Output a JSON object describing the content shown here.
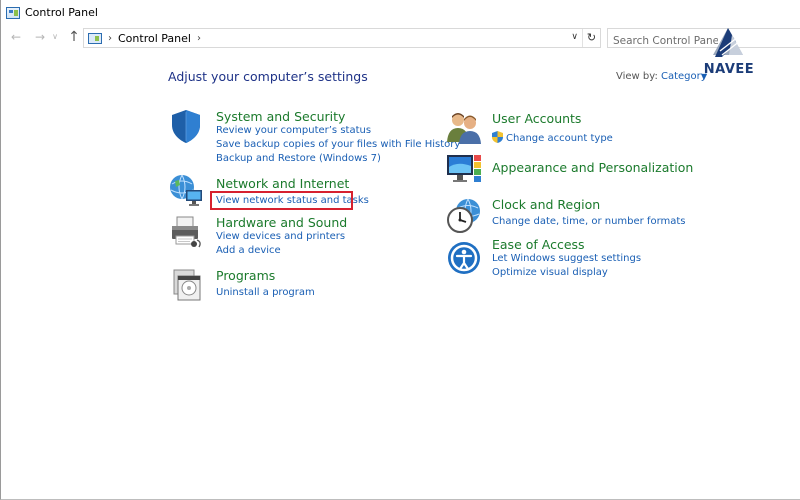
{
  "window": {
    "title": "Control Panel"
  },
  "address_bar": {
    "path": "Control Panel",
    "separator": "›"
  },
  "search": {
    "placeholder": "Search Control Panel"
  },
  "logo": {
    "text": "NAVEE"
  },
  "main": {
    "heading": "Adjust your computer’s settings",
    "view_by_label": "View by:",
    "view_by_value": "Category"
  },
  "categories_left": [
    {
      "title": "System and Security",
      "icon": "shield-icon",
      "links": [
        "Review your computer’s status",
        "Save backup copies of your files with File History",
        "Backup and Restore (Windows 7)"
      ]
    },
    {
      "title": "Network and Internet",
      "icon": "network-globe-icon",
      "links": [
        "View network status and tasks"
      ]
    },
    {
      "title": "Hardware and Sound",
      "icon": "printer-icon",
      "links": [
        "View devices and printers",
        "Add a device"
      ]
    },
    {
      "title": "Programs",
      "icon": "programs-icon",
      "links": [
        "Uninstall a program"
      ]
    }
  ],
  "categories_right": [
    {
      "title": "User Accounts",
      "icon": "users-icon",
      "links": [
        "Change account type"
      ]
    },
    {
      "title": "Appearance and Personalization",
      "icon": "monitor-palette-icon",
      "links": []
    },
    {
      "title": "Clock and Region",
      "icon": "clock-globe-icon",
      "links": [
        "Change date, time, or number formats"
      ]
    },
    {
      "title": "Ease of Access",
      "icon": "ease-of-access-icon",
      "links": [
        "Let Windows suggest settings",
        "Optimize visual display"
      ]
    }
  ],
  "highlight": {
    "color": "#d6212f",
    "target": "View network status and tasks"
  },
  "colors": {
    "category_title": "#1b7a2c",
    "link": "#1a5fb4",
    "heading": "#1e3287"
  }
}
